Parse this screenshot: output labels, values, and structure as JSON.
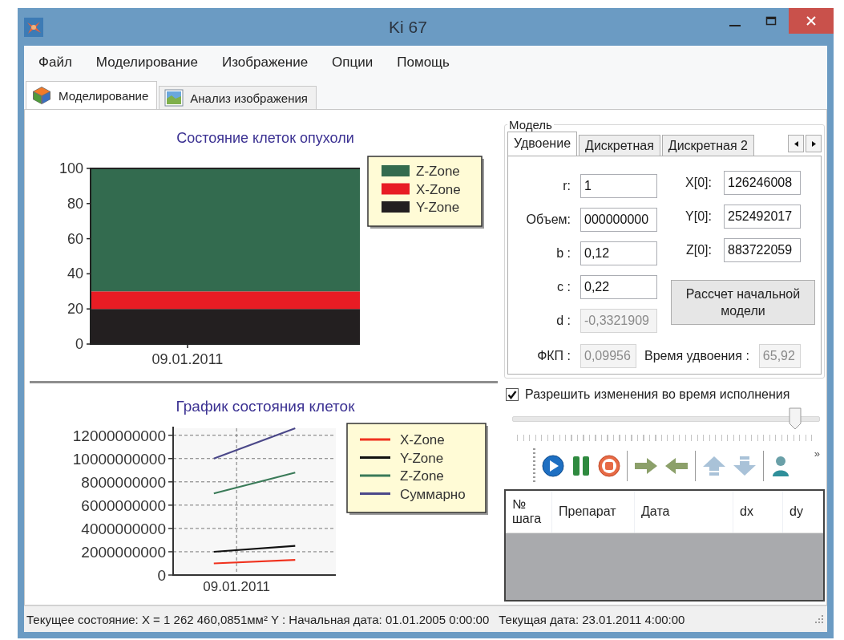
{
  "window": {
    "title": "Ki 67"
  },
  "menu": [
    "Файл",
    "Моделирование",
    "Изображение",
    "Опции",
    "Помощь"
  ],
  "tabs": [
    {
      "label": "Моделирование",
      "selected": true
    },
    {
      "label": "Анализ изображения",
      "selected": false
    }
  ],
  "tumor_chart": {
    "chart_data": {
      "type": "bar",
      "stacked": true,
      "title": "Состояние клеток опухоли",
      "categories": [
        "09.01.2011"
      ],
      "series": [
        {
          "name": "Z-Zone",
          "color": "#336b4f",
          "values": [
            70
          ]
        },
        {
          "name": "X-Zone",
          "color": "#e81c24",
          "values": [
            10
          ]
        },
        {
          "name": "Y-Zone",
          "color": "#231f20",
          "values": [
            20
          ]
        }
      ],
      "ylim": [
        0,
        100
      ],
      "yticks": [
        0,
        20,
        40,
        60,
        80,
        100
      ],
      "legend": "right"
    }
  },
  "cells_chart": {
    "chart_data": {
      "type": "line",
      "title": "График состояния клеток",
      "categories": [
        null,
        null
      ],
      "annotations": [
        {
          "text": "09.01.2011"
        }
      ],
      "legend": "right",
      "grid": true,
      "series": [
        {
          "name": "X-Zone",
          "color": "#f0321e",
          "values": [
            1000000000,
            1300000000
          ]
        },
        {
          "name": "Y-Zone",
          "color": "#111111",
          "values": [
            2000000000,
            2500000000
          ]
        },
        {
          "name": "Z-Zone",
          "color": "#3a7a58",
          "values": [
            7000000000,
            8800000000
          ]
        },
        {
          "name": "Суммарно",
          "color": "#4b4889",
          "values": [
            10000000000,
            12600000000
          ]
        }
      ],
      "ylim": [
        0,
        12600000000
      ],
      "yticks": [
        {
          "value": 0,
          "label": "0"
        },
        {
          "value": 2000000000,
          "label": "2000000000"
        },
        {
          "value": 4000000000,
          "label": "4000000000"
        },
        {
          "value": 6000000000,
          "label": "6000000000"
        },
        {
          "value": 8000000000,
          "label": "8000000000"
        },
        {
          "value": 10000000000,
          "label": "10000000000"
        },
        {
          "value": 12000000000,
          "label": "12000000000"
        }
      ]
    }
  },
  "model": {
    "title": "Модель",
    "tabs": [
      {
        "label": "Удвоение",
        "selected": true
      },
      {
        "label": "Дискретная",
        "selected": false
      },
      {
        "label": "Дискретная 2",
        "selected": false
      }
    ],
    "fields_left": [
      {
        "label": "r:",
        "value": "1",
        "disabled": false
      },
      {
        "label": "Объем:",
        "value": "000000000",
        "disabled": false
      },
      {
        "label": "b :",
        "value": "0,12",
        "disabled": false
      },
      {
        "label": "c :",
        "value": "0,22",
        "disabled": false
      },
      {
        "label": "d :",
        "value": "-0,3321909",
        "disabled": true
      }
    ],
    "fields_right": [
      {
        "label": "X[0]:",
        "value": "126246008",
        "disabled": false
      },
      {
        "label": "Y[0]:",
        "value": "252492017",
        "disabled": false
      },
      {
        "label": "Z[0]:",
        "value": "883722059",
        "disabled": false
      }
    ],
    "calc_button": "Рассчет начальной модели",
    "bottom_fields": [
      {
        "label": "ФКП :",
        "value": "0,09956",
        "disabled": true
      },
      {
        "label": "Время удвоения :",
        "value": "65,92",
        "disabled": true
      }
    ]
  },
  "runtime_changes": {
    "label": "Разрешить изменения во время исполнения",
    "checked": true
  },
  "speed_slider": {
    "level": 0.92
  },
  "toolbar": {
    "overflow": "»"
  },
  "steps_table": {
    "columns": [
      "№ шага",
      "Препарат",
      "Дата",
      "dx",
      "dy"
    ]
  },
  "status_bar": [
    "Текущее состояние: X = 1 262 460,0851мм² Y : Начальная дата: 01.01.2005 0:00:00",
    "Текущая дата: 23.01.2011 4:00:00"
  ]
}
